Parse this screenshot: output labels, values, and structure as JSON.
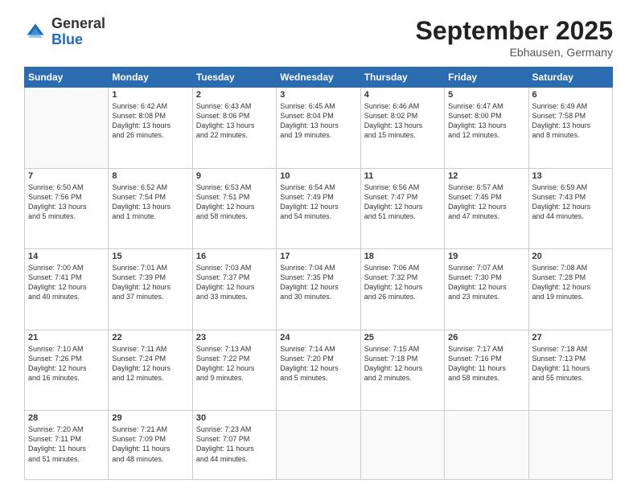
{
  "logo": {
    "general": "General",
    "blue": "Blue"
  },
  "title": "September 2025",
  "location": "Ebhausen, Germany",
  "days_header": [
    "Sunday",
    "Monday",
    "Tuesday",
    "Wednesday",
    "Thursday",
    "Friday",
    "Saturday"
  ],
  "weeks": [
    [
      {
        "day": "",
        "info": ""
      },
      {
        "day": "1",
        "info": "Sunrise: 6:42 AM\nSunset: 8:08 PM\nDaylight: 13 hours\nand 26 minutes."
      },
      {
        "day": "2",
        "info": "Sunrise: 6:43 AM\nSunset: 8:06 PM\nDaylight: 13 hours\nand 22 minutes."
      },
      {
        "day": "3",
        "info": "Sunrise: 6:45 AM\nSunset: 8:04 PM\nDaylight: 13 hours\nand 19 minutes."
      },
      {
        "day": "4",
        "info": "Sunrise: 6:46 AM\nSunset: 8:02 PM\nDaylight: 13 hours\nand 15 minutes."
      },
      {
        "day": "5",
        "info": "Sunrise: 6:47 AM\nSunset: 8:00 PM\nDaylight: 13 hours\nand 12 minutes."
      },
      {
        "day": "6",
        "info": "Sunrise: 6:49 AM\nSunset: 7:58 PM\nDaylight: 13 hours\nand 8 minutes."
      }
    ],
    [
      {
        "day": "7",
        "info": "Sunrise: 6:50 AM\nSunset: 7:56 PM\nDaylight: 13 hours\nand 5 minutes."
      },
      {
        "day": "8",
        "info": "Sunrise: 6:52 AM\nSunset: 7:54 PM\nDaylight: 13 hours\nand 1 minute."
      },
      {
        "day": "9",
        "info": "Sunrise: 6:53 AM\nSunset: 7:51 PM\nDaylight: 12 hours\nand 58 minutes."
      },
      {
        "day": "10",
        "info": "Sunrise: 6:54 AM\nSunset: 7:49 PM\nDaylight: 12 hours\nand 54 minutes."
      },
      {
        "day": "11",
        "info": "Sunrise: 6:56 AM\nSunset: 7:47 PM\nDaylight: 12 hours\nand 51 minutes."
      },
      {
        "day": "12",
        "info": "Sunrise: 6:57 AM\nSunset: 7:45 PM\nDaylight: 12 hours\nand 47 minutes."
      },
      {
        "day": "13",
        "info": "Sunrise: 6:59 AM\nSunset: 7:43 PM\nDaylight: 12 hours\nand 44 minutes."
      }
    ],
    [
      {
        "day": "14",
        "info": "Sunrise: 7:00 AM\nSunset: 7:41 PM\nDaylight: 12 hours\nand 40 minutes."
      },
      {
        "day": "15",
        "info": "Sunrise: 7:01 AM\nSunset: 7:39 PM\nDaylight: 12 hours\nand 37 minutes."
      },
      {
        "day": "16",
        "info": "Sunrise: 7:03 AM\nSunset: 7:37 PM\nDaylight: 12 hours\nand 33 minutes."
      },
      {
        "day": "17",
        "info": "Sunrise: 7:04 AM\nSunset: 7:35 PM\nDaylight: 12 hours\nand 30 minutes."
      },
      {
        "day": "18",
        "info": "Sunrise: 7:06 AM\nSunset: 7:32 PM\nDaylight: 12 hours\nand 26 minutes."
      },
      {
        "day": "19",
        "info": "Sunrise: 7:07 AM\nSunset: 7:30 PM\nDaylight: 12 hours\nand 23 minutes."
      },
      {
        "day": "20",
        "info": "Sunrise: 7:08 AM\nSunset: 7:28 PM\nDaylight: 12 hours\nand 19 minutes."
      }
    ],
    [
      {
        "day": "21",
        "info": "Sunrise: 7:10 AM\nSunset: 7:26 PM\nDaylight: 12 hours\nand 16 minutes."
      },
      {
        "day": "22",
        "info": "Sunrise: 7:11 AM\nSunset: 7:24 PM\nDaylight: 12 hours\nand 12 minutes."
      },
      {
        "day": "23",
        "info": "Sunrise: 7:13 AM\nSunset: 7:22 PM\nDaylight: 12 hours\nand 9 minutes."
      },
      {
        "day": "24",
        "info": "Sunrise: 7:14 AM\nSunset: 7:20 PM\nDaylight: 12 hours\nand 5 minutes."
      },
      {
        "day": "25",
        "info": "Sunrise: 7:15 AM\nSunset: 7:18 PM\nDaylight: 12 hours\nand 2 minutes."
      },
      {
        "day": "26",
        "info": "Sunrise: 7:17 AM\nSunset: 7:16 PM\nDaylight: 11 hours\nand 58 minutes."
      },
      {
        "day": "27",
        "info": "Sunrise: 7:18 AM\nSunset: 7:13 PM\nDaylight: 11 hours\nand 55 minutes."
      }
    ],
    [
      {
        "day": "28",
        "info": "Sunrise: 7:20 AM\nSunset: 7:11 PM\nDaylight: 11 hours\nand 51 minutes."
      },
      {
        "day": "29",
        "info": "Sunrise: 7:21 AM\nSunset: 7:09 PM\nDaylight: 11 hours\nand 48 minutes."
      },
      {
        "day": "30",
        "info": "Sunrise: 7:23 AM\nSunset: 7:07 PM\nDaylight: 11 hours\nand 44 minutes."
      },
      {
        "day": "",
        "info": ""
      },
      {
        "day": "",
        "info": ""
      },
      {
        "day": "",
        "info": ""
      },
      {
        "day": "",
        "info": ""
      }
    ]
  ]
}
